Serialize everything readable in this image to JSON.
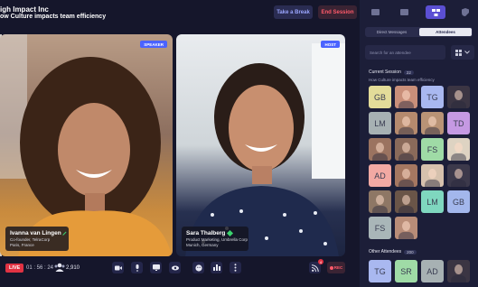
{
  "header": {
    "title": "igh Impact Inc",
    "subtitle": "ow Culture impacts team efficiency",
    "break_label": "Take a Break",
    "end_label": "End Session"
  },
  "tiles": [
    {
      "badge": "SPEAKER",
      "name": "Ivanna van Lingen",
      "line1": "Co-founder, TelraCorp",
      "line2": "Paris, France"
    },
    {
      "badge": "HOST",
      "name": "Sara Thalberg",
      "line1": "Product Marketing, Umbrella Corp",
      "line2": "Munich, Germany"
    }
  ],
  "toolbar": {
    "live_label": "LIVE",
    "timer": "01 : 56 : 24",
    "audience_count": "2,910",
    "notification_count": "4",
    "rec_label": "REC"
  },
  "sidebar": {
    "tabs": [
      "people",
      "chat",
      "attendees",
      "shield"
    ],
    "toggle": [
      "Direct Messages",
      "Attendees"
    ],
    "search_placeholder": "Search for an attendee",
    "current_label": "Current Session",
    "current_count": "22",
    "current_topic": "How Culture impacts team efficiency",
    "other_label": "Other Attendees",
    "other_count": "200",
    "avatars": [
      {
        "initials": "GB",
        "color": "#e3dc99"
      },
      {
        "initials": "",
        "color": "#c98f7a"
      },
      {
        "initials": "TG",
        "color": "#a9b8f0"
      },
      {
        "initials": "",
        "color": "#3b3543"
      },
      {
        "initials": "LM",
        "color": "#a7b1b3"
      },
      {
        "initials": "",
        "color": "#b58a6e"
      },
      {
        "initials": "",
        "color": "#b99376"
      },
      {
        "initials": "TD",
        "color": "#c599e3"
      },
      {
        "initials": "",
        "color": "#9b7360"
      },
      {
        "initials": "",
        "color": "#8a6a5a"
      },
      {
        "initials": "FS",
        "color": "#9fdba6"
      },
      {
        "initials": "",
        "color": "#ded3c2"
      },
      {
        "initials": "AD",
        "color": "#f2a9a3"
      },
      {
        "initials": "",
        "color": "#a57761"
      },
      {
        "initials": "",
        "color": "#d6c1ad"
      },
      {
        "initials": "",
        "color": "#3c394b"
      },
      {
        "initials": "",
        "color": "#8e7765"
      },
      {
        "initials": "",
        "color": "#6a5548"
      },
      {
        "initials": "LM",
        "color": "#7fd7bf"
      },
      {
        "initials": "GB",
        "color": "#a3b7ec"
      },
      {
        "initials": "FS",
        "color": "#a9b6b8"
      },
      {
        "initials": "",
        "color": "#b98d78"
      }
    ],
    "other_avatars": [
      {
        "initials": "TG",
        "color": "#a9b8f0"
      },
      {
        "initials": "SR",
        "color": "#9fdba6"
      },
      {
        "initials": "AD",
        "color": "#a7b1b3"
      },
      {
        "initials": "",
        "color": "#3b3543"
      }
    ]
  }
}
